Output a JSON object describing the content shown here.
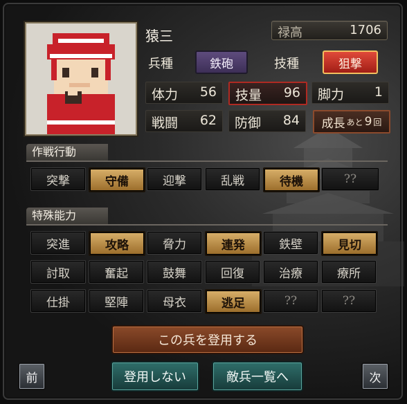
{
  "unit": {
    "name": "猿三",
    "stipend_label": "禄高",
    "stipend_value": "1706",
    "troop_type_label": "兵種",
    "troop_type_value": "鉄砲",
    "skill_type_label": "技種",
    "skill_type_value": "狙撃",
    "stats": {
      "hp": {
        "label": "体力",
        "value": "56"
      },
      "skill": {
        "label": "技量",
        "value": "96"
      },
      "speed": {
        "label": "脚力",
        "value": "1"
      },
      "attack": {
        "label": "戦闘",
        "value": "62"
      },
      "defense": {
        "label": "防御",
        "value": "84"
      }
    },
    "growth": {
      "label": "成長",
      "mid": "あと",
      "value": "9",
      "unit": "回"
    }
  },
  "tactics": {
    "title": "作戦行動",
    "items": [
      {
        "label": "突撃",
        "active": false
      },
      {
        "label": "守備",
        "active": true
      },
      {
        "label": "迎撃",
        "active": false
      },
      {
        "label": "乱戦",
        "active": false
      },
      {
        "label": "待機",
        "active": true
      },
      {
        "label": "??",
        "active": false
      }
    ]
  },
  "abilities": {
    "title": "特殊能力",
    "items": [
      {
        "label": "突進",
        "active": false
      },
      {
        "label": "攻略",
        "active": true
      },
      {
        "label": "脅力",
        "active": false
      },
      {
        "label": "連発",
        "active": true
      },
      {
        "label": "鉄壁",
        "active": false
      },
      {
        "label": "見切",
        "active": true
      },
      {
        "label": "討取",
        "active": false
      },
      {
        "label": "奮起",
        "active": false
      },
      {
        "label": "鼓舞",
        "active": false
      },
      {
        "label": "回復",
        "active": false
      },
      {
        "label": "治療",
        "active": false
      },
      {
        "label": "療所",
        "active": false
      },
      {
        "label": "仕掛",
        "active": false
      },
      {
        "label": "堅陣",
        "active": false
      },
      {
        "label": "母衣",
        "active": false
      },
      {
        "label": "逃足",
        "active": true
      },
      {
        "label": "??",
        "active": false
      },
      {
        "label": "??",
        "active": false
      }
    ]
  },
  "actions": {
    "recruit": "この兵を登用する",
    "decline": "登用しない",
    "enemy_list": "敵兵一覧へ",
    "prev": "前",
    "next": "次"
  }
}
